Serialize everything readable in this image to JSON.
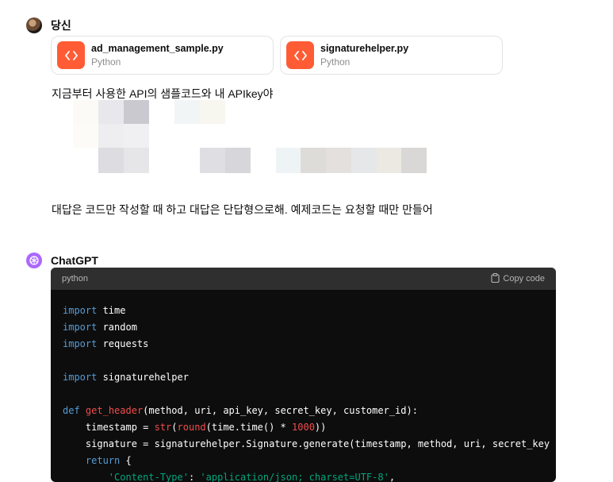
{
  "user_message": {
    "sender": "당신",
    "attachments": [
      {
        "name": "ad_management_sample.py",
        "type": "Python",
        "icon": "code-file-icon"
      },
      {
        "name": "signaturehelper.py",
        "type": "Python",
        "icon": "code-file-icon"
      }
    ],
    "text": "지금부터 사용한 API의 샘플코드와 내 APIkey야",
    "text2": "대답은 코드만 작성할 때 하고 대답은 단답형으로해. 예제코드는 요청할 때만 만들어"
  },
  "assistant_message": {
    "sender": "ChatGPT",
    "code": {
      "language": "python",
      "copy_label": "Copy code",
      "lines": [
        "import time",
        "import random",
        "import requests",
        "",
        "import signaturehelper",
        "",
        "def get_header(method, uri, api_key, secret_key, customer_id):",
        "    timestamp = str(round(time.time() * 1000))",
        "    signature = signaturehelper.Signature.generate(timestamp, method, uri, secret_key",
        "    return {",
        "        'Content-Type': 'application/json; charset=UTF-8',"
      ]
    }
  },
  "colors": {
    "accent_file": "#ff5c35",
    "gpt_avatar": "#ab68ff",
    "code_bg": "#0d0d0d"
  }
}
